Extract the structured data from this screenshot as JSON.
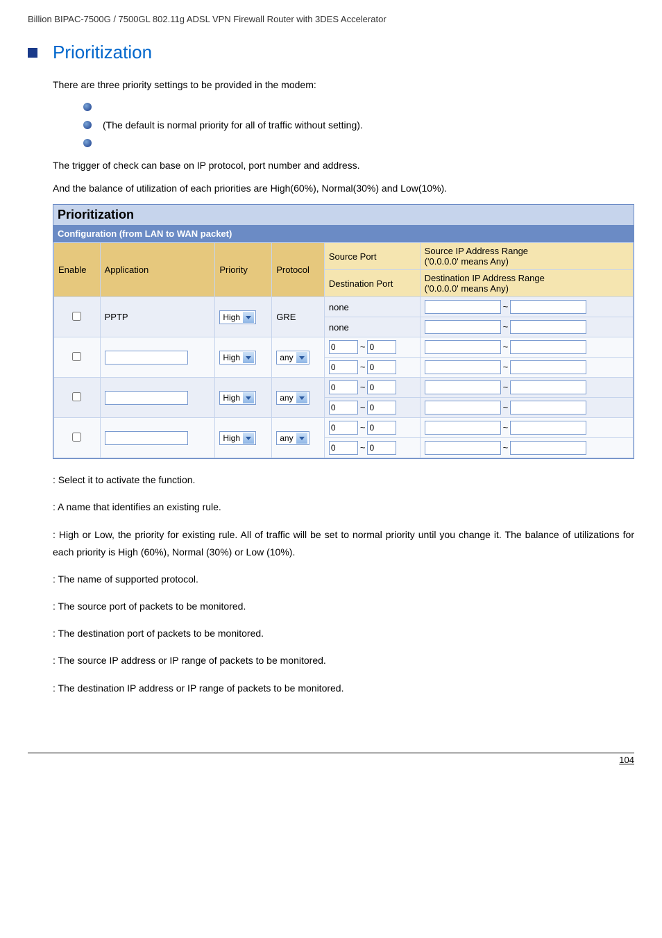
{
  "header": "Billion BIPAC-7500G / 7500GL 802.11g ADSL VPN Firewall Router with 3DES Accelerator",
  "pageTitle": "Prioritization",
  "intro": "There are three priority settings to be provided in the modem:",
  "bullets": {
    "b1": "",
    "b2": "(The default is normal priority for all of traffic without setting).",
    "b3": ""
  },
  "para1": "The trigger of check can base on IP protocol, port number and address.",
  "para2": "And the balance of utilization of each priorities are High(60%), Normal(30%) and Low(10%).",
  "tableTitle": "Prioritization",
  "tableSubtitle": "Configuration (from LAN to WAN packet)",
  "headers": {
    "enable": "Enable",
    "application": "Application",
    "priority": "Priority",
    "protocol": "Protocol",
    "sourcePort": "Source Port",
    "destPort": "Destination Port",
    "sourceIp": "Source IP Address Range\n('0.0.0.0' means Any)",
    "destIp": "Destination IP Address Range\n('0.0.0.0' means Any)"
  },
  "selects": {
    "priorityHigh": "High",
    "protocolAny": "any"
  },
  "rows": [
    {
      "app": "PPTP",
      "appFixed": true,
      "protocol": "GRE",
      "protocolFixed": true,
      "sourcePort": "none",
      "destPort": "none",
      "portFixed": true,
      "srcA": "",
      "srcB": "",
      "dstA": "",
      "dstB": ""
    },
    {
      "app": "",
      "appFixed": false,
      "protocolFixed": false,
      "portFixed": false,
      "spA": "0",
      "spB": "0",
      "dpA": "0",
      "dpB": "0",
      "srcA": "",
      "srcB": "",
      "dstA": "",
      "dstB": ""
    },
    {
      "app": "",
      "appFixed": false,
      "protocolFixed": false,
      "portFixed": false,
      "spA": "0",
      "spB": "0",
      "dpA": "0",
      "dpB": "0",
      "srcA": "",
      "srcB": "",
      "dstA": "",
      "dstB": ""
    },
    {
      "app": "",
      "appFixed": false,
      "protocolFixed": false,
      "portFixed": false,
      "spA": "0",
      "spB": "0",
      "dpA": "0",
      "dpB": "0",
      "srcA": "",
      "srcB": "",
      "dstA": "",
      "dstB": ""
    }
  ],
  "defs": {
    "enable": ": Select it to activate the function.",
    "application": ": A name that identifies an existing rule.",
    "priority": ": High or Low, the priority for existing rule. All of traffic will be set to normal priority until you change it. The balance of utilizations for each priority is High (60%), Normal (30%) or Low (10%).",
    "protocol": ": The name of supported protocol.",
    "sourcePort": ": The source port of packets to be monitored.",
    "destPort": ": The destination port of packets to be monitored.",
    "sourceIp": ": The source IP address or IP range of packets to be monitored.",
    "destIp": ": The destination IP address or IP range of packets to be monitored."
  },
  "pageNumber": "104"
}
